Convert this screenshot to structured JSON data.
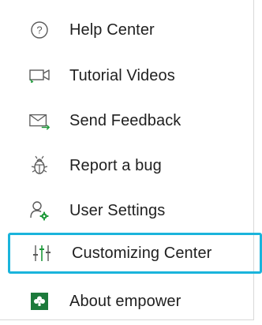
{
  "menu": {
    "items": [
      {
        "label": "Help Center",
        "icon": "help-circle-icon"
      },
      {
        "label": "Tutorial Videos",
        "icon": "video-camera-icon"
      },
      {
        "label": "Send Feedback",
        "icon": "envelope-arrow-icon"
      },
      {
        "label": "Report a bug",
        "icon": "bug-icon"
      },
      {
        "label": "User Settings",
        "icon": "user-gear-icon"
      },
      {
        "label": "Customizing Center",
        "icon": "sliders-icon"
      },
      {
        "label": "About empower",
        "icon": "empower-logo-icon"
      }
    ],
    "selected_index": 5
  },
  "colors": {
    "text": "#1f1f1f",
    "icon_gray": "#5a5a5a",
    "accent_green": "#1e9a3a",
    "logo_green": "#1c7a3b",
    "selection_border": "#1ab4dc"
  }
}
